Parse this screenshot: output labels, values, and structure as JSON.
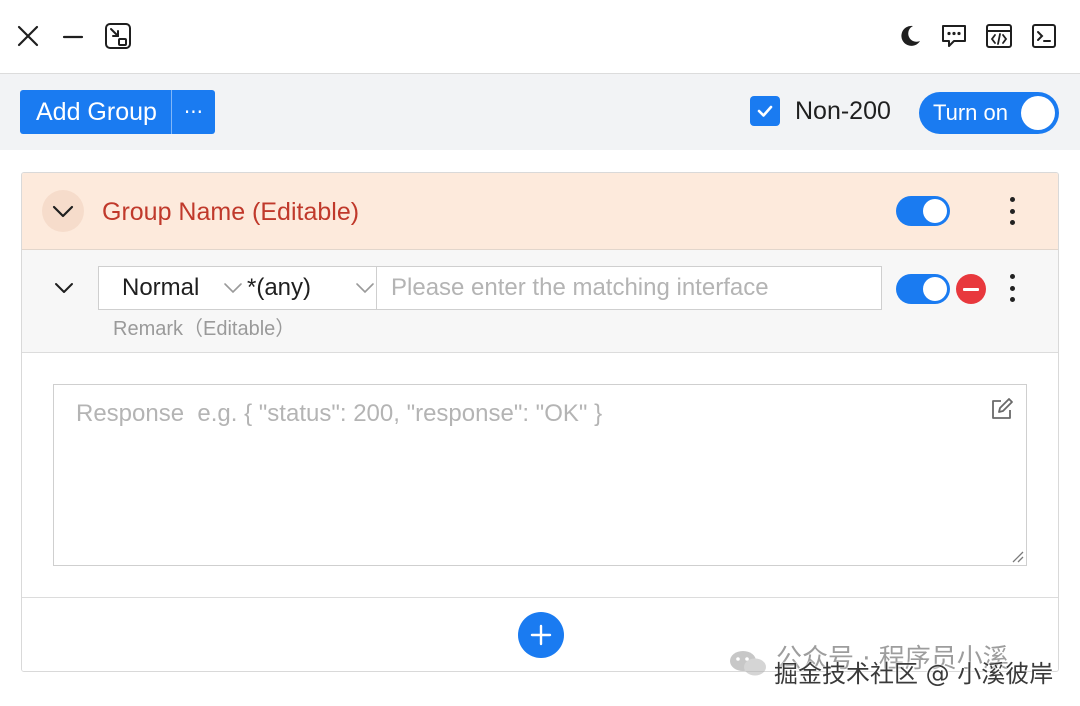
{
  "titlebar": {
    "icons": [
      "close-icon",
      "minimize-icon",
      "picture-in-picture-icon",
      "moon-icon",
      "feedback-icon",
      "code-window-icon",
      "terminal-icon"
    ]
  },
  "toolbar": {
    "add_group_label": "Add Group",
    "more_label": "···",
    "non200_checked": true,
    "non200_label": "Non-200",
    "turn_on_label": "Turn on",
    "turn_on_enabled": true
  },
  "group": {
    "name": "Group Name (Editable)",
    "enabled": true,
    "rule": {
      "type_value": "Normal",
      "method_value": "*(any)",
      "url_placeholder": "Please enter the matching interface",
      "url_value": "",
      "remark": "Remark（Editable）",
      "enabled": true,
      "response_placeholder": "Response  e.g. { \"status\": 200, \"response\": \"OK\" }",
      "response_value": ""
    }
  },
  "watermark": {
    "line1": "公众号 · 程序员小溪",
    "line2": "掘金技术社区 @ 小溪彼岸"
  },
  "colors": {
    "accent": "#1a7bf1",
    "group_header_bg": "#fdeadc",
    "group_title": "#c0392b",
    "danger": "#e8383d"
  }
}
